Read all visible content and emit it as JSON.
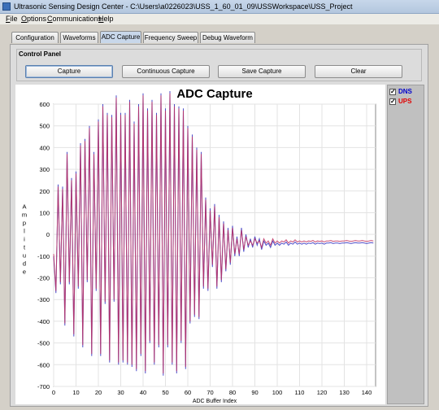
{
  "window": {
    "title": "Ultrasonic Sensing Design Center - C:\\Users\\a0226023\\USS_1_60_01_09\\USSWorkspace\\USS_Project"
  },
  "menu": [
    {
      "label": "File",
      "key": "F",
      "rest": "ile"
    },
    {
      "label": "Options",
      "key": "O",
      "rest": "ptions"
    },
    {
      "label": "Communications",
      "key": "C",
      "rest": "ommunications"
    },
    {
      "label": "Help",
      "key": "H",
      "rest": "elp"
    }
  ],
  "tabs": [
    "Configuration",
    "Waveforms",
    "ADC Capture",
    "Frequency Sweep",
    "Debug Waveform"
  ],
  "active_tab": "ADC Capture",
  "control_panel": {
    "title": "Control Panel",
    "buttons": [
      "Capture",
      "Continuous Capture",
      "Save Capture",
      "Clear"
    ]
  },
  "legend": [
    {
      "label": "DNS",
      "checked": true,
      "color": "#0000cc"
    },
    {
      "label": "UPS",
      "checked": true,
      "color": "#e00000"
    }
  ],
  "chart_data": {
    "type": "line",
    "title": "ADC Capture",
    "xlabel": "ADC Buffer Index",
    "ylabel": "Amplitude",
    "xlim": [
      0,
      144
    ],
    "ylim": [
      -700,
      600
    ],
    "xticks": [
      0,
      10,
      20,
      30,
      40,
      50,
      60,
      70,
      80,
      90,
      100,
      110,
      120,
      130,
      140
    ],
    "yticks": [
      600,
      500,
      400,
      300,
      200,
      100,
      0,
      -100,
      -200,
      -300,
      -400,
      -500,
      -600,
      -700
    ],
    "grid": true,
    "series_colors": {
      "DNS": "#3030c0",
      "UPS": "#c03060"
    },
    "x": [
      0,
      1,
      2,
      3,
      4,
      5,
      6,
      7,
      8,
      9,
      10,
      11,
      12,
      13,
      14,
      15,
      16,
      17,
      18,
      19,
      20,
      21,
      22,
      23,
      24,
      25,
      26,
      27,
      28,
      29,
      30,
      31,
      32,
      33,
      34,
      35,
      36,
      37,
      38,
      39,
      40,
      41,
      42,
      43,
      44,
      45,
      46,
      47,
      48,
      49,
      50,
      51,
      52,
      53,
      54,
      55,
      56,
      57,
      58,
      59,
      60,
      61,
      62,
      63,
      64,
      65,
      66,
      67,
      68,
      69,
      70,
      71,
      72,
      73,
      74,
      75,
      76,
      77,
      78,
      79,
      80,
      81,
      82,
      83,
      84,
      85,
      86,
      87,
      88,
      89,
      90,
      91,
      92,
      93,
      94,
      95,
      96,
      97,
      98,
      99,
      100,
      101,
      102,
      103,
      104,
      105,
      106,
      107,
      108,
      109,
      110,
      111,
      112,
      113,
      114,
      115,
      116,
      117,
      118,
      119,
      120,
      121,
      122,
      123,
      124,
      125,
      126,
      127,
      128,
      129,
      130,
      131,
      132,
      133,
      134,
      135,
      136,
      137,
      138,
      139,
      140,
      141,
      142,
      143
    ],
    "series": [
      {
        "name": "DNS",
        "values": [
          -100,
          -270,
          230,
          -230,
          220,
          -420,
          380,
          -230,
          260,
          -470,
          290,
          -250,
          420,
          -520,
          440,
          -220,
          500,
          -560,
          380,
          -260,
          530,
          -560,
          600,
          -320,
          560,
          -590,
          550,
          -310,
          640,
          -600,
          560,
          -590,
          560,
          -600,
          620,
          -610,
          520,
          -630,
          600,
          -560,
          650,
          -640,
          580,
          -500,
          620,
          -600,
          560,
          -520,
          650,
          -650,
          580,
          -520,
          660,
          -600,
          600,
          -640,
          590,
          -500,
          580,
          -620,
          500,
          -410,
          460,
          -380,
          400,
          -390,
          380,
          -250,
          170,
          -260,
          120,
          -150,
          140,
          -250,
          90,
          -220,
          60,
          -170,
          30,
          -140,
          40,
          -100,
          -10,
          -100,
          30,
          -80,
          0,
          -60,
          -20,
          -60,
          -10,
          -50,
          -20,
          -70,
          -30,
          -50,
          -40,
          -60,
          -30,
          -50,
          -40,
          -50,
          -40,
          -45,
          -35,
          -50,
          -40,
          -45,
          -35,
          -45,
          -40,
          -45,
          -40,
          -45,
          -40,
          -42,
          -38,
          -45,
          -40,
          -42,
          -40,
          -45,
          -40,
          -40,
          -38,
          -42,
          -40,
          -40,
          -42,
          -40,
          -40,
          -38,
          -40,
          -42,
          -40,
          -38,
          -40,
          -40,
          -38,
          -40,
          -42,
          -40,
          -38,
          -40
        ]
      },
      {
        "name": "UPS",
        "values": [
          -90,
          -260,
          220,
          -220,
          210,
          -410,
          370,
          -220,
          250,
          -460,
          280,
          -240,
          410,
          -510,
          430,
          -210,
          490,
          -550,
          370,
          -250,
          520,
          -550,
          590,
          -310,
          550,
          -580,
          540,
          -300,
          630,
          -590,
          550,
          -580,
          550,
          -590,
          610,
          -600,
          510,
          -620,
          590,
          -550,
          640,
          -630,
          570,
          -490,
          610,
          -590,
          550,
          -510,
          640,
          -640,
          570,
          -510,
          650,
          -590,
          590,
          -630,
          580,
          -490,
          570,
          -610,
          490,
          -400,
          450,
          -370,
          390,
          -380,
          370,
          -240,
          160,
          -250,
          110,
          -140,
          130,
          -240,
          80,
          -210,
          50,
          -160,
          20,
          -130,
          30,
          -90,
          -20,
          -90,
          20,
          -70,
          -10,
          -50,
          -30,
          -50,
          -20,
          -40,
          -30,
          -60,
          -20,
          -40,
          -30,
          -50,
          -20,
          -40,
          -30,
          -40,
          -30,
          -35,
          -25,
          -40,
          -30,
          -35,
          -25,
          -35,
          -30,
          -35,
          -30,
          -35,
          -30,
          -32,
          -28,
          -35,
          -30,
          -32,
          -30,
          -35,
          -30,
          -30,
          -28,
          -32,
          -30,
          -30,
          -32,
          -30,
          -30,
          -28,
          -30,
          -32,
          -30,
          -28,
          -30,
          -30,
          -28,
          -30,
          -32,
          -30,
          -28,
          -30
        ]
      }
    ]
  }
}
